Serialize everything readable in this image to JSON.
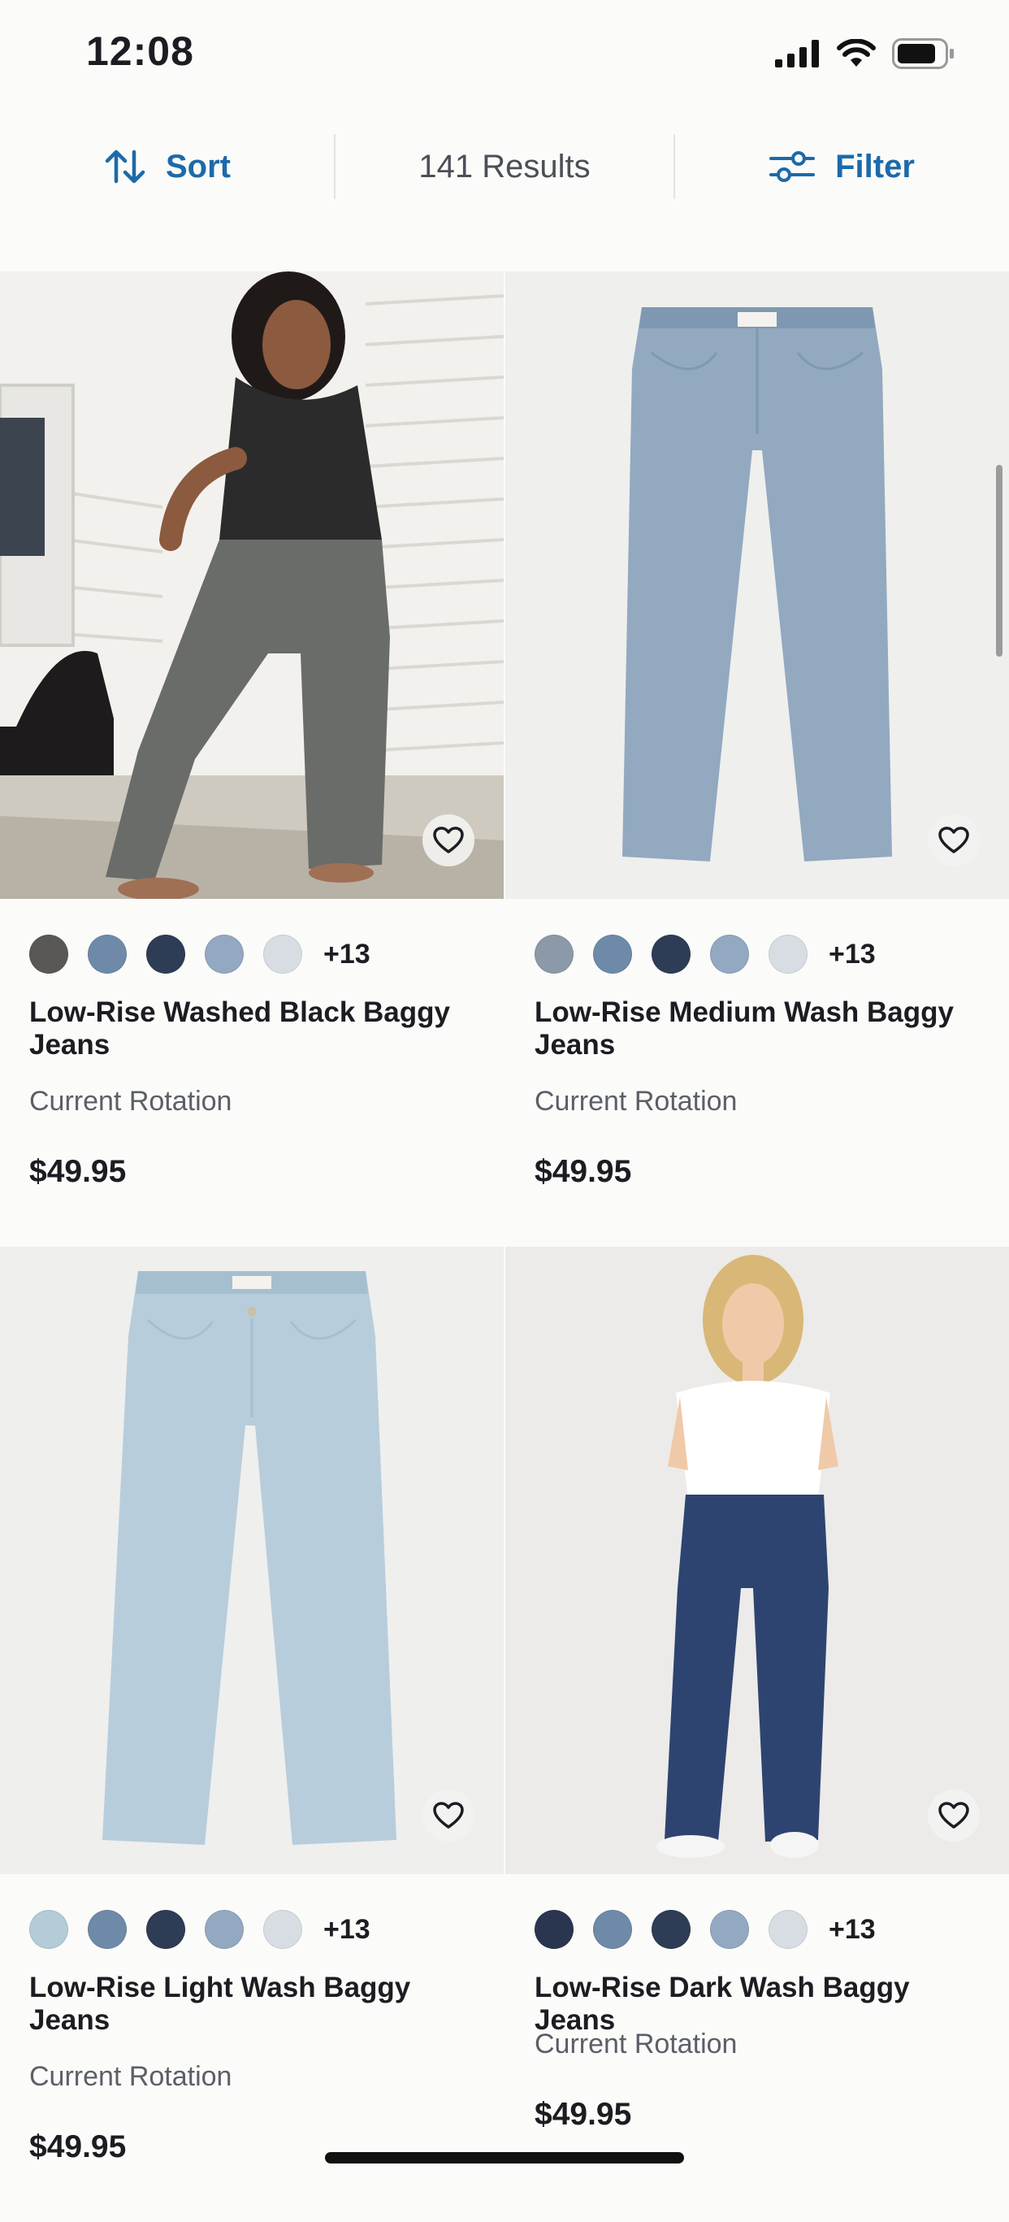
{
  "status_bar": {
    "time": "12:08"
  },
  "toolbar": {
    "sort_label": "Sort",
    "results_label": "141 Results",
    "filter_label": "Filter"
  },
  "products": [
    {
      "title": "Low-Rise Washed Black Baggy Jeans",
      "subtitle": "Current Rotation",
      "price": "$49.95",
      "more_colors": "+13",
      "swatches": [
        "#5a5856",
        "#6f8aa8",
        "#2e3d55",
        "#93a8c1",
        "#d7dde2"
      ]
    },
    {
      "title": "Low-Rise Medium Wash Baggy Jeans",
      "subtitle": "Current Rotation",
      "price": "$49.95",
      "more_colors": "+13",
      "swatches": [
        "#8c99a8",
        "#6f8aa8",
        "#2e3d55",
        "#93a8c1",
        "#d7dde2"
      ]
    },
    {
      "title": "Low-Rise Light Wash Baggy Jeans",
      "subtitle": "Current Rotation",
      "price": "$49.95",
      "more_colors": "+13",
      "swatches": [
        "#b4cbd8",
        "#6f8aa8",
        "#2e3d55",
        "#93a8c1",
        "#d7dde2"
      ]
    },
    {
      "title": "Low-Rise Dark Wash Baggy Jeans",
      "subtitle": "Current Rotation",
      "price": "$49.95",
      "more_colors": "+13",
      "swatches": [
        "#2a3650",
        "#6f8aa8",
        "#2e3d55",
        "#93a8c1",
        "#d7dde2"
      ]
    }
  ],
  "colors": {
    "accent": "#1c6aaa"
  }
}
